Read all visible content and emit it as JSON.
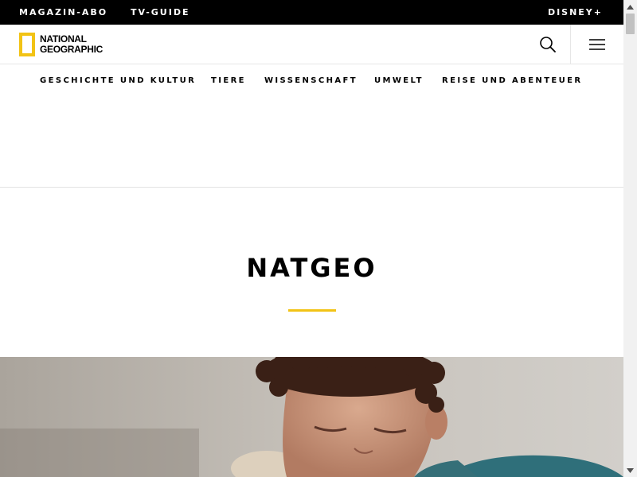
{
  "topbar": {
    "magazin_abo": "MAGAZIN-ABO",
    "tv_guide": "TV-GUIDE",
    "disney": "DISNEY+"
  },
  "header": {
    "logo_line1": "NATIONAL",
    "logo_line2": "GEOGRAPHIC",
    "search_icon": "search-icon",
    "menu_icon": "hamburger-menu-icon"
  },
  "nav": {
    "items": [
      {
        "label": "GESCHICHTE UND KULTUR"
      },
      {
        "label": "TIERE"
      },
      {
        "label": "WISSENSCHAFT"
      },
      {
        "label": "UMWELT"
      },
      {
        "label": "REISE UND ABENTEUER"
      }
    ]
  },
  "main": {
    "title": "NATGEO"
  },
  "colors": {
    "brand_yellow": "#f2c315",
    "topbar_bg": "#000000"
  }
}
